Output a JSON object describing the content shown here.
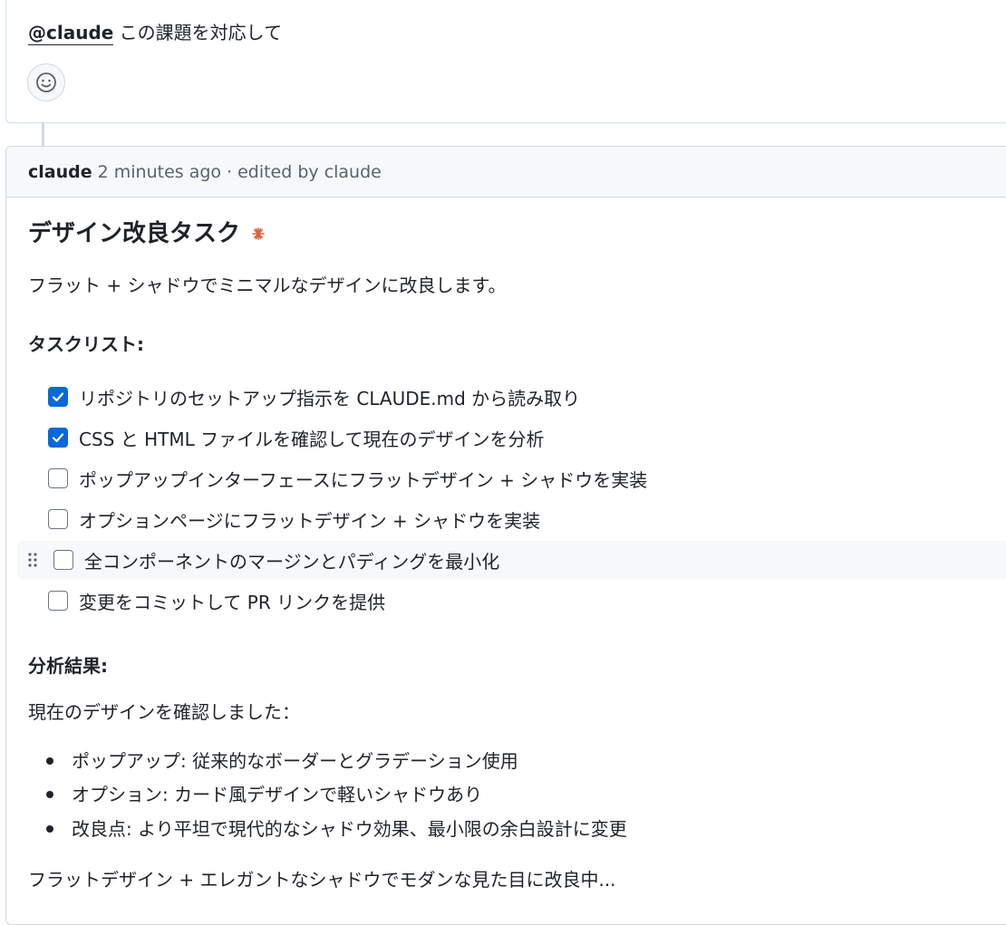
{
  "top_comment": {
    "mention": "@claude",
    "text": " この課題を対応して"
  },
  "comment": {
    "author": "claude",
    "time": "2 minutes ago",
    "separator": "·",
    "edited": "edited by claude",
    "heading": "デザイン改良タスク",
    "intro": "フラット + シャドウでミニマルなデザインに改良します。",
    "task_heading": "タスクリスト:",
    "tasks": [
      {
        "label": "リポジトリのセットアップ指示を CLAUDE.md から読み取り",
        "checked": true
      },
      {
        "label": "CSS と HTML ファイルを確認して現在のデザインを分析",
        "checked": true
      },
      {
        "label": "ポップアップインターフェースにフラットデザイン + シャドウを実装",
        "checked": false
      },
      {
        "label": "オプションページにフラットデザイン + シャドウを実装",
        "checked": false
      },
      {
        "label": "全コンポーネントのマージンとパディングを最小化",
        "checked": false
      },
      {
        "label": "変更をコミットして PR リンクを提供",
        "checked": false
      }
    ],
    "analysis_heading": "分析結果:",
    "analysis_intro": "現在のデザインを確認しました：",
    "bullets": [
      "ポップアップ: 従来的なボーダーとグラデーション使用",
      "オプション: カード風デザインで軽いシャドウあり",
      "改良点: より平坦で現代的なシャドウ効果、最小限の余白設計に変更"
    ],
    "footer": "フラットデザイン + エレガントなシャドウでモダンな見た目に改良中..."
  },
  "colors": {
    "accent": "#0969da",
    "spark": "#d9623b"
  }
}
